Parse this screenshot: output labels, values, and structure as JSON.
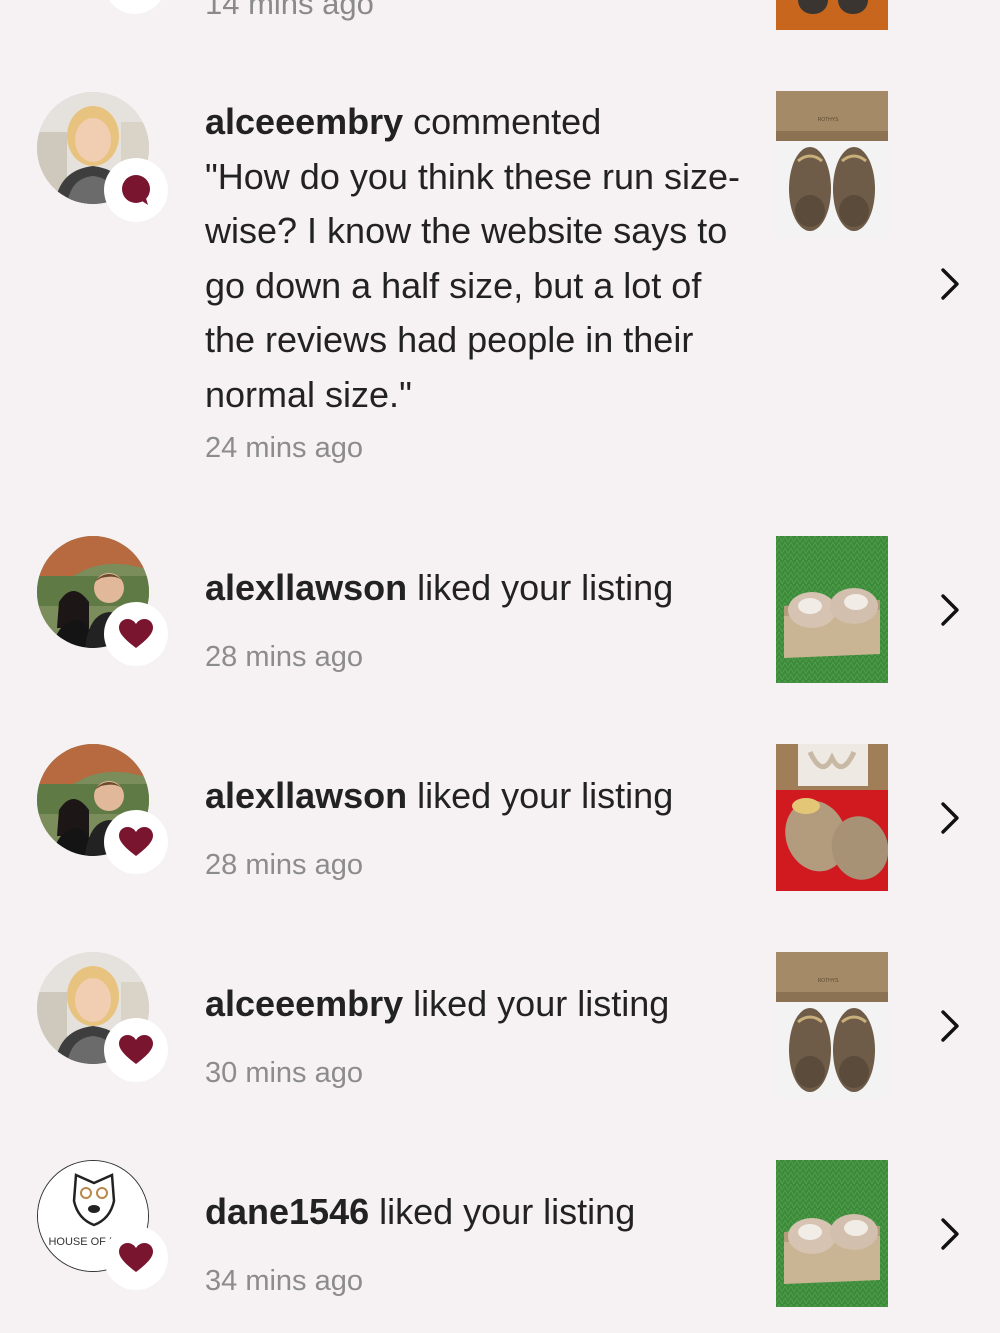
{
  "top_fragment": {
    "time": "14 mins ago"
  },
  "notifications": [
    {
      "user": "alceeembry",
      "action": " commented",
      "comment": "\"How do you think these run size-wise? I know the website says to go down a half size, but a lot of the reviews had people in their normal size.\"",
      "time": "24 mins ago",
      "badge_icon": "comment-icon",
      "thumb_box_label": "ROTHYS"
    },
    {
      "user": "alexllawson",
      "action": " liked your listing",
      "time": "28 mins ago",
      "badge_icon": "heart-icon"
    },
    {
      "user": "alexllawson",
      "action": " liked your listing",
      "time": "28 mins ago",
      "badge_icon": "heart-icon"
    },
    {
      "user": "alceeembry",
      "action": " liked your listing",
      "time": "30 mins ago",
      "badge_icon": "heart-icon",
      "thumb_box_label": "ROTHYS"
    },
    {
      "user": "dane1546",
      "action": " liked your listing",
      "time": "34 mins ago",
      "badge_icon": "heart-icon",
      "avatar_text": "HOUSE OF DANE"
    }
  ],
  "colors": {
    "background": "#f6f1f3",
    "badge_icon": "#7a1530",
    "text": "#222222",
    "time": "#8c8c8c"
  }
}
